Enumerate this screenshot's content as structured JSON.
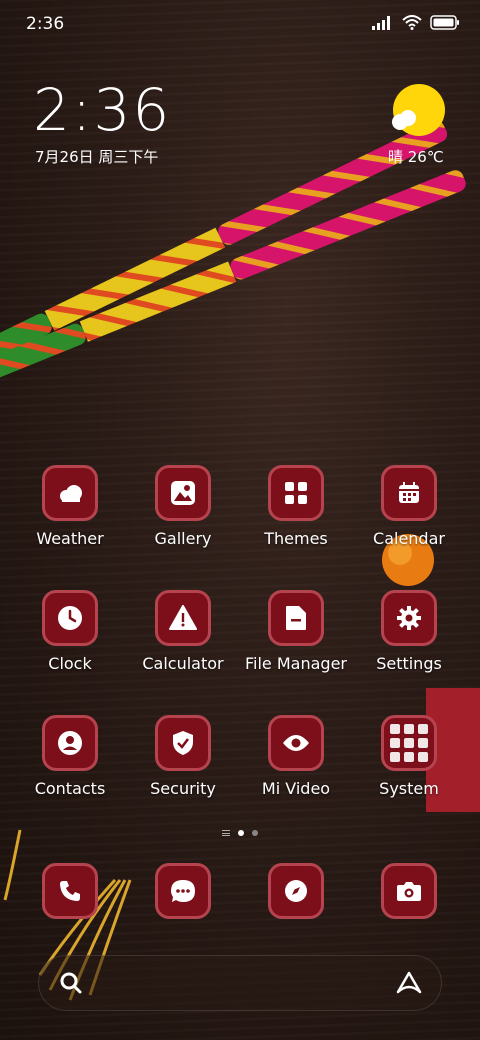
{
  "status_bar": {
    "time": "2:36"
  },
  "clock_widget": {
    "time": "2:36",
    "date": "7月26日 周三下午"
  },
  "weather_widget": {
    "text": "晴 26℃"
  },
  "apps": [
    {
      "label": "Weather",
      "icon": "weather-icon"
    },
    {
      "label": "Gallery",
      "icon": "gallery-icon"
    },
    {
      "label": "Themes",
      "icon": "themes-icon"
    },
    {
      "label": "Calendar",
      "icon": "calendar-icon"
    },
    {
      "label": "Clock",
      "icon": "clock-icon"
    },
    {
      "label": "Calculator",
      "icon": "calculator-icon"
    },
    {
      "label": "File Manager",
      "icon": "file-manager-icon"
    },
    {
      "label": "Settings",
      "icon": "settings-icon"
    },
    {
      "label": "Contacts",
      "icon": "contacts-icon"
    },
    {
      "label": "Security",
      "icon": "security-icon"
    },
    {
      "label": "Mi Video",
      "icon": "mi-video-icon"
    },
    {
      "label": "System",
      "icon": "system-folder-icon"
    }
  ],
  "dock": [
    {
      "icon": "phone-icon"
    },
    {
      "icon": "messages-icon"
    },
    {
      "icon": "browser-icon"
    },
    {
      "icon": "camera-icon"
    }
  ],
  "page_indicator": {
    "pages": 2,
    "current": 1
  },
  "theme": {
    "tile_color": "#7d0f1a",
    "tile_border": "#b6444f",
    "sun_color": "#ffd60a"
  }
}
